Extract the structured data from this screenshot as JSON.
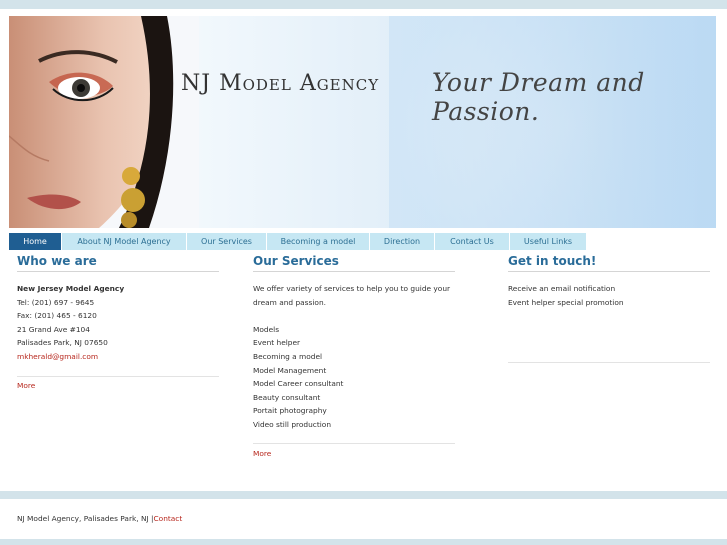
{
  "header": {
    "brand": "NJ Model Agency",
    "tagline": "Your Dream and Passion."
  },
  "nav": [
    {
      "label": "Home",
      "active": true
    },
    {
      "label": "About NJ Model Agency",
      "active": false
    },
    {
      "label": "Our Services",
      "active": false
    },
    {
      "label": "Becoming a model",
      "active": false
    },
    {
      "label": "Direction",
      "active": false
    },
    {
      "label": "Contact Us",
      "active": false
    },
    {
      "label": "Useful Links",
      "active": false
    }
  ],
  "who": {
    "title": "Who we are",
    "name": "New Jersey Model Agency",
    "tel": "Tel: (201) 697 - 9645",
    "fax": "Fax: (201) 465 - 6120",
    "addr1": "21 Grand Ave #104",
    "addr2": "Palisades Park, NJ 07650",
    "email": "mkherald@gmail.com",
    "more": "More"
  },
  "services": {
    "title": "Our Services",
    "intro1": "We offer variety of services to help you to guide your",
    "intro2": "dream and passion.",
    "items": [
      "Models",
      "Event helper",
      "Becoming a model",
      "Model Management",
      "Model Career consultant",
      "Beauty consultant",
      "Portait photography",
      "Video still production"
    ],
    "more": "More"
  },
  "touch": {
    "title": "Get in touch!",
    "line1": "Receive an email notification",
    "line2": "Event helper special promotion"
  },
  "footer": {
    "text": "NJ Model Agency, Palisades Park, NJ |",
    "contact": "Contact"
  },
  "colors": {
    "accent": "#2a6c99",
    "nav_bg": "#c6e7f3",
    "nav_active": "#1f5e92",
    "link_red": "#b7261c",
    "bar": "#d3e3ea"
  }
}
